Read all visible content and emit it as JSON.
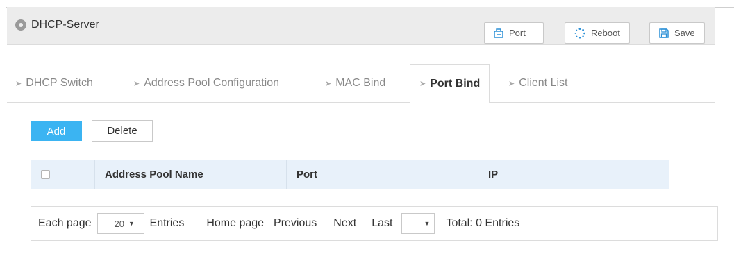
{
  "header": {
    "title": "DHCP-Server",
    "port_label": "Port",
    "reboot_label": "Reboot",
    "save_label": "Save"
  },
  "tabs": [
    {
      "label": "DHCP Switch"
    },
    {
      "label": "Address Pool Configuration"
    },
    {
      "label": "MAC Bind"
    },
    {
      "label": "Port Bind"
    },
    {
      "label": "Client List"
    }
  ],
  "active_tab": "Port Bind",
  "actions": {
    "add_label": "Add",
    "delete_label": "Delete"
  },
  "table": {
    "columns": [
      "Address Pool Name",
      "Port",
      "IP"
    ],
    "rows": []
  },
  "pager": {
    "each_page_label": "Each page",
    "page_size": "20",
    "entries_label": "Entries",
    "home_label": "Home page",
    "previous_label": "Previous",
    "next_label": "Next",
    "last_label": "Last",
    "jump_value": "",
    "total_label": "Total: 0 Entries"
  },
  "colors": {
    "accent": "#3bb4f2",
    "table_header_bg": "#e8f1fa",
    "header_bg": "#ececec"
  },
  "icons": [
    "location-dot-icon",
    "port-icon",
    "reboot-spinner-icon",
    "save-icon",
    "tab-arrow-icon",
    "caret-down-icon"
  ]
}
